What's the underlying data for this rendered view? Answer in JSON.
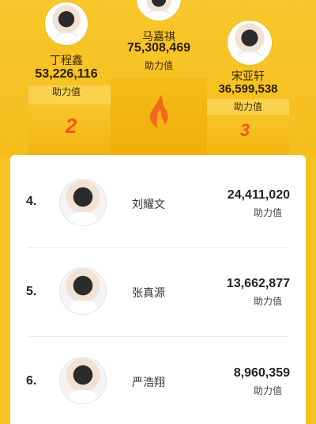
{
  "podium": {
    "first": {
      "name": "马嘉祺",
      "score": "75,308,469",
      "unit": "助力值"
    },
    "second": {
      "name": "丁程鑫",
      "score": "53,226,116",
      "unit": "助力值",
      "rank": "2"
    },
    "third": {
      "name": "宋亚轩",
      "score": "36,599,538",
      "unit": "助力值",
      "rank": "3"
    }
  },
  "list": [
    {
      "rank": "4.",
      "name": "刘耀文",
      "score": "24,411,020",
      "unit": "助力值"
    },
    {
      "rank": "5.",
      "name": "张真源",
      "score": "13,662,877",
      "unit": "助力值"
    },
    {
      "rank": "6.",
      "name": "严浩翔",
      "score": "8,960,359",
      "unit": "助力值"
    }
  ],
  "colors": {
    "background": "#f6c220",
    "rank_accent": "#ef5a1a",
    "card": "#ffffff"
  }
}
